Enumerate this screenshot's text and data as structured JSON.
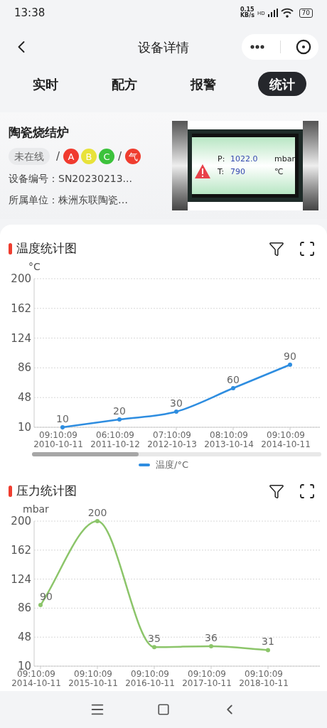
{
  "status_bar": {
    "time": "13:38",
    "net_speed": "0.15",
    "net_unit": "KB/s",
    "network_type": "HD",
    "battery": "70"
  },
  "nav": {
    "title": "设备详情"
  },
  "tabs": [
    {
      "label": "实时",
      "selected": false
    },
    {
      "label": "配方",
      "selected": false
    },
    {
      "label": "报警",
      "selected": false
    },
    {
      "label": "统计",
      "selected": true
    }
  ],
  "device": {
    "name": "陶瓷烧结炉",
    "status": "未在线",
    "indicators": [
      {
        "kind": "separator",
        "text": "/"
      },
      {
        "kind": "dot",
        "text": "A",
        "color": "#f03a2e"
      },
      {
        "kind": "dot",
        "text": "B",
        "color": "#e8e23a"
      },
      {
        "kind": "dot",
        "text": "C",
        "color": "#3cc23c"
      },
      {
        "kind": "separator",
        "text": "/"
      },
      {
        "kind": "dot",
        "text": "气",
        "color": "#ef3d2f"
      }
    ],
    "info": [
      {
        "label": "设备编号：",
        "value": "SN20230213..."
      },
      {
        "label": "所属单位：",
        "value": "株洲东联陶瓷…"
      }
    ],
    "display": {
      "rows": [
        {
          "label": "P:",
          "value": "1022.0",
          "unit": "mbar"
        },
        {
          "label": "T:",
          "value": "790",
          "unit": "℃"
        }
      ],
      "alarm": true
    }
  },
  "charts": [
    {
      "title": "温度统计图",
      "legend": true,
      "scrollbar": true,
      "chart_data": {
        "type": "line",
        "ylabel": "°C",
        "categories": [
          "09:10:09 2010-10-11",
          "06:10:09 2011-10-12",
          "07:10:09 2012-10-13",
          "08:10:09 2013-10-14",
          "09:10:09 2014-10-11"
        ],
        "ylim": [
          10,
          200
        ],
        "yticks": [
          10,
          48,
          86,
          124,
          162,
          200
        ],
        "data_labels": true,
        "grid": true,
        "series": [
          {
            "name": "温度/°C",
            "color": "#2e8de0",
            "marker": true,
            "values": [
              10,
              20,
              30,
              60,
              90
            ]
          }
        ]
      }
    },
    {
      "title": "压力统计图",
      "legend": false,
      "scrollbar": false,
      "chart_data": {
        "type": "line",
        "ylabel": "mbar",
        "categories": [
          "09:10:09 2014-10-11",
          "09:10:09 2015-10-11",
          "09:10:09 2016-10-11",
          "09:10:09 2017-10-11",
          "09:10:09 2018-10-11"
        ],
        "ylim": [
          10,
          200
        ],
        "yticks": [
          10,
          48,
          86,
          124,
          162,
          200
        ],
        "data_labels": true,
        "grid": true,
        "series": [
          {
            "color": "#8cc56a",
            "marker": true,
            "values": [
              90,
              200,
              35,
              36,
              31
            ]
          }
        ]
      }
    }
  ]
}
